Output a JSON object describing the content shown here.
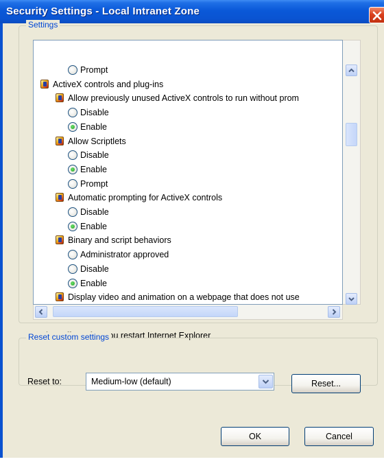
{
  "window": {
    "title": "Security Settings - Local Intranet Zone"
  },
  "settings_group": {
    "label": "Settings",
    "items": [
      {
        "kind": "radio",
        "level": 2,
        "label": "Prompt",
        "checked": false
      },
      {
        "kind": "category",
        "level": 0,
        "label": "ActiveX controls and plug-ins"
      },
      {
        "kind": "setting",
        "level": 1,
        "label": "Allow previously unused ActiveX controls to run without prom"
      },
      {
        "kind": "radio",
        "level": 2,
        "label": "Disable",
        "checked": false
      },
      {
        "kind": "radio",
        "level": 2,
        "label": "Enable",
        "checked": true
      },
      {
        "kind": "setting",
        "level": 1,
        "label": "Allow Scriptlets"
      },
      {
        "kind": "radio",
        "level": 2,
        "label": "Disable",
        "checked": false
      },
      {
        "kind": "radio",
        "level": 2,
        "label": "Enable",
        "checked": true
      },
      {
        "kind": "radio",
        "level": 2,
        "label": "Prompt",
        "checked": false
      },
      {
        "kind": "setting",
        "level": 1,
        "label": "Automatic prompting for ActiveX controls"
      },
      {
        "kind": "radio",
        "level": 2,
        "label": "Disable",
        "checked": false
      },
      {
        "kind": "radio",
        "level": 2,
        "label": "Enable",
        "checked": true
      },
      {
        "kind": "setting",
        "level": 1,
        "label": "Binary and script behaviors"
      },
      {
        "kind": "radio",
        "level": 2,
        "label": "Administrator approved",
        "checked": false
      },
      {
        "kind": "radio",
        "level": 2,
        "label": "Disable",
        "checked": false
      },
      {
        "kind": "radio",
        "level": 2,
        "label": "Enable",
        "checked": true
      },
      {
        "kind": "setting",
        "level": 1,
        "label": "Display video and animation on a webpage that does not use"
      }
    ],
    "note": "*Takes effect after you restart Internet Explorer"
  },
  "reset_group": {
    "label": "Reset custom settings",
    "reset_to_label": "Reset to:",
    "selected_level": "Medium-low (default)",
    "reset_button": "Reset..."
  },
  "footer": {
    "ok_label": "OK",
    "cancel_label": "Cancel"
  },
  "colors": {
    "titlebar": "#0a58d8",
    "group_label": "#0046d5",
    "close_button": "#d9401e",
    "radio_checked": "#21a121"
  }
}
